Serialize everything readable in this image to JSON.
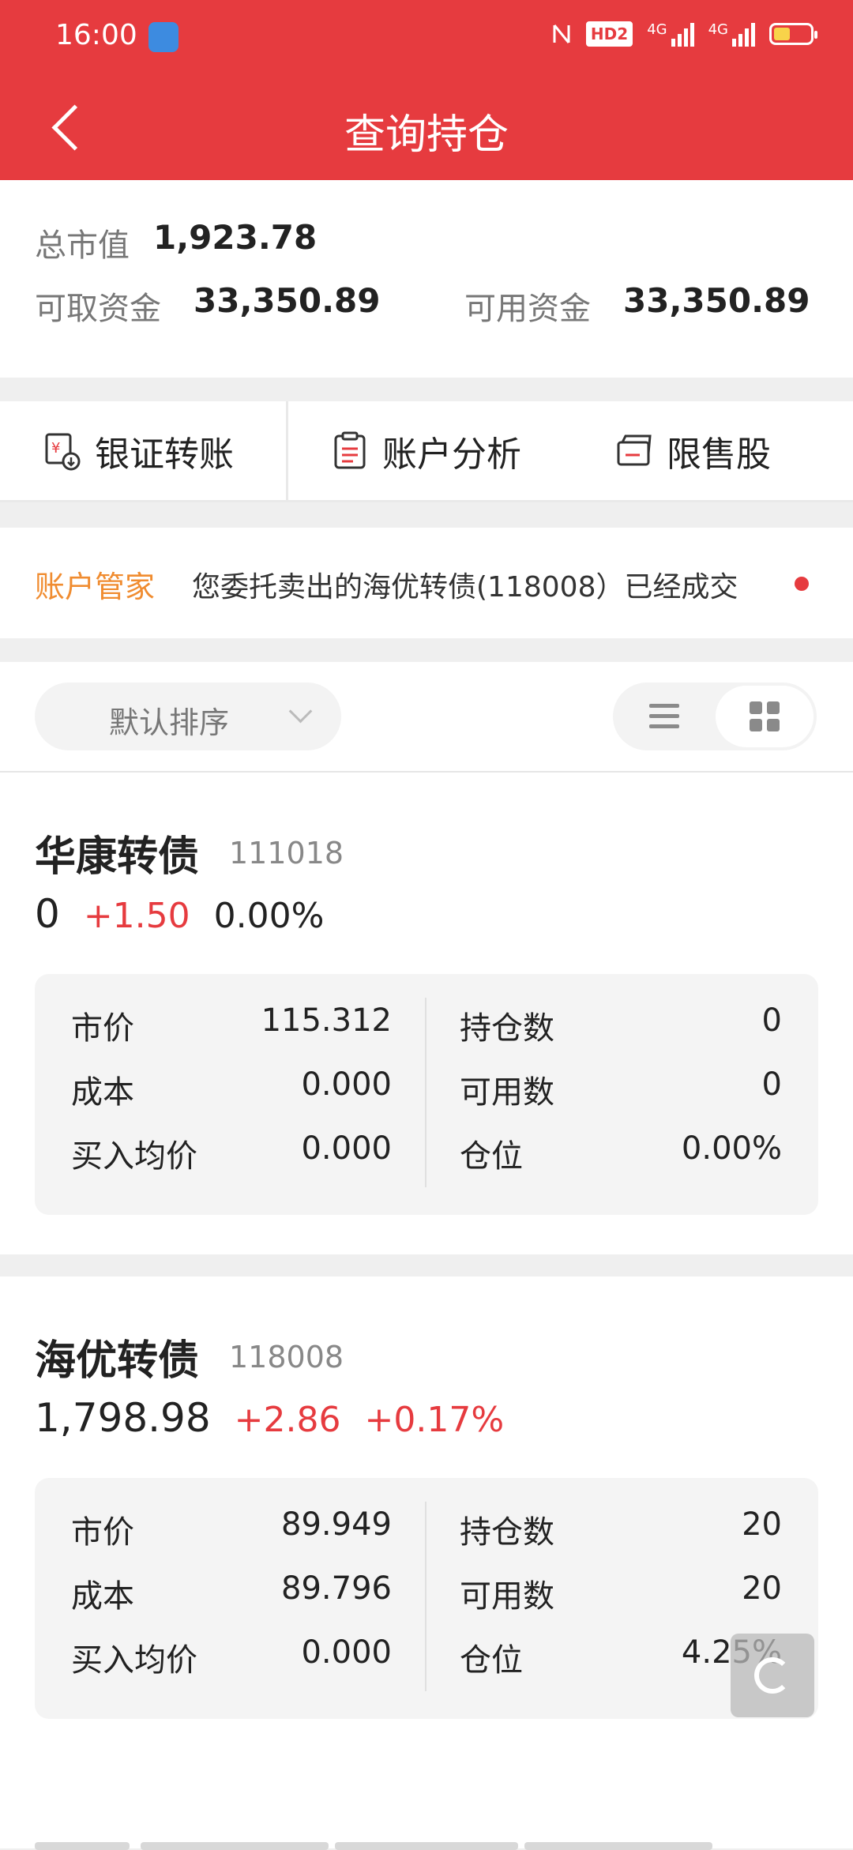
{
  "status_bar": {
    "time": "16:00",
    "hd_label": "HD2",
    "signal1_label": "4G",
    "signal2_label": "4G",
    "battery_level": 0.45
  },
  "header": {
    "title": "查询持仓"
  },
  "summary": {
    "total_value_label": "总市值",
    "total_value": "1,923.78",
    "withdrawable_label": "可取资金",
    "withdrawable": "33,350.89",
    "available_label": "可用资金",
    "available": "33,350.89"
  },
  "actions": [
    {
      "label": "银证转账",
      "icon": "bank-transfer-icon"
    },
    {
      "label": "账户分析",
      "icon": "clipboard-icon"
    },
    {
      "label": "限售股",
      "icon": "wallet-icon"
    }
  ],
  "notice": {
    "tag": "账户管家",
    "text": "您委托卖出的海优转债(118008）已经成交"
  },
  "sort": {
    "label": "默认排序"
  },
  "positions": [
    {
      "name": "华康转债",
      "code": "111018",
      "value": "0",
      "change": "+1.50",
      "change_pct": "0.00%",
      "market_price_label": "市价",
      "market_price": "115.312",
      "cost_label": "成本",
      "cost": "0.000",
      "avg_buy_label": "买入均价",
      "avg_buy": "0.000",
      "holdings_label": "持仓数",
      "holdings": "0",
      "available_label": "可用数",
      "available": "0",
      "position_label": "仓位",
      "position": "0.00%"
    },
    {
      "name": "海优转债",
      "code": "118008",
      "value": "1,798.98",
      "change": "+2.86",
      "change_pct": "+0.17%",
      "market_price_label": "市价",
      "market_price": "89.949",
      "cost_label": "成本",
      "cost": "89.796",
      "avg_buy_label": "买入均价",
      "avg_buy": "0.000",
      "holdings_label": "持仓数",
      "holdings": "20",
      "available_label": "可用数",
      "available": "20",
      "position_label": "仓位",
      "position": "4.25%"
    }
  ],
  "colors": {
    "brand_red": "#e63b3f",
    "notice_orange": "#f08c30"
  }
}
